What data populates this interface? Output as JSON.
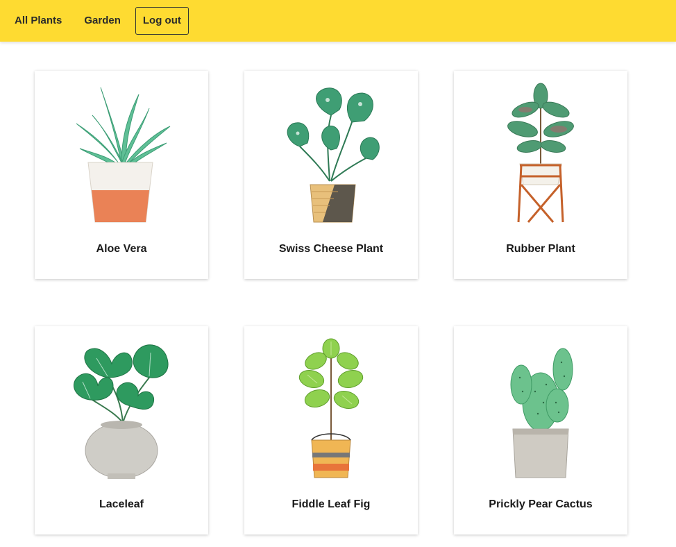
{
  "nav": {
    "all_plants": "All Plants",
    "garden": "Garden",
    "logout": "Log out"
  },
  "colors": {
    "header_bg": "#fedb31",
    "card_shadow": "rgba(0,0,0,0.22)"
  },
  "plants": [
    {
      "name": "Aloe Vera",
      "subtitle": "",
      "icon": "aloe-vera-illustration"
    },
    {
      "name": "Swiss Cheese Plant",
      "subtitle": "",
      "icon": "swiss-cheese-plant-illustration"
    },
    {
      "name": "Rubber Plant",
      "subtitle": "",
      "icon": "rubber-plant-illustration"
    },
    {
      "name": "Laceleaf",
      "subtitle": "",
      "icon": "laceleaf-illustration"
    },
    {
      "name": "Fiddle Leaf Fig",
      "subtitle": "",
      "icon": "fiddle-leaf-fig-illustration"
    },
    {
      "name": "Prickly Pear Cactus",
      "subtitle": "",
      "icon": "prickly-pear-cactus-illustration"
    }
  ]
}
